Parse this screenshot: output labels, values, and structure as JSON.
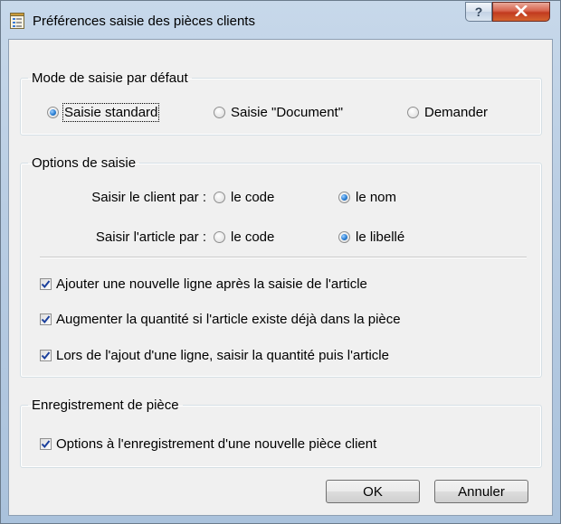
{
  "window": {
    "title": "Préférences saisie des pièces clients",
    "help_label": "?",
    "icons": {
      "app": "form-icon",
      "help": "question-icon",
      "close": "close-icon"
    }
  },
  "mode_group": {
    "legend": "Mode de saisie par défaut",
    "options": [
      {
        "label": "Saisie standard",
        "selected": true
      },
      {
        "label": "Saisie \"Document\"",
        "selected": false
      },
      {
        "label": "Demander",
        "selected": false
      }
    ]
  },
  "options_group": {
    "legend": "Options de saisie",
    "client_row": {
      "label": "Saisir le client par :",
      "options": [
        {
          "label": "le code",
          "selected": false
        },
        {
          "label": "le nom",
          "selected": true
        }
      ]
    },
    "article_row": {
      "label": "Saisir l'article par :",
      "options": [
        {
          "label": "le code",
          "selected": false
        },
        {
          "label": "le libellé",
          "selected": true
        }
      ]
    },
    "checkboxes": [
      {
        "label": "Ajouter une nouvelle ligne après la saisie de l'article",
        "checked": true
      },
      {
        "label": "Augmenter la quantité si l'article existe déjà dans la pièce",
        "checked": true
      },
      {
        "label": "Lors de l'ajout d'une ligne, saisir la quantité puis l'article",
        "checked": true
      }
    ]
  },
  "save_group": {
    "legend": "Enregistrement de pièce",
    "checkbox": {
      "label": "Options à l'enregistrement d'une nouvelle pièce client",
      "checked": true
    }
  },
  "buttons": {
    "ok": "OK",
    "cancel": "Annuler"
  },
  "colors": {
    "check_mark": "#1a3f9c",
    "radio_selected": "#2a7fd4",
    "close_button": "#c23a1f"
  }
}
